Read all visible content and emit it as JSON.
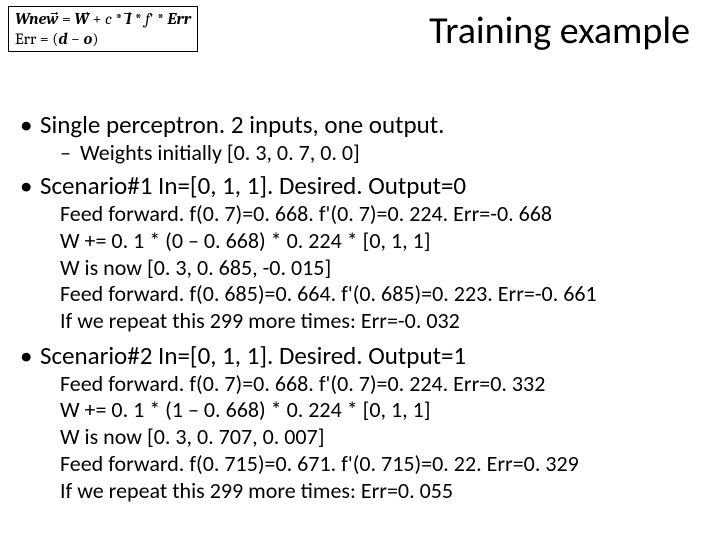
{
  "formula": {
    "line1_html": "<b><i>Wnew</i></b>&#8407; = <b><i>W</i></b>&#8407; + <i>c</i> * <b><i>I</i></b>&#8407; * <i>f</i>' * <b><i>Err</i></b>",
    "line2_html": "Err = (<b><i>d</i></b> &minus; <b><i>o</i></b>)"
  },
  "title": "Training example",
  "bullets": {
    "b1a": "Single perceptron.  2 inputs, one output.",
    "b2a": "Weights initially [0. 3, 0. 7, 0. 0]",
    "b1b": "Scenario#1 In=[0, 1, 1].  Desired. Output=0",
    "body1": [
      "Feed forward.  f(0. 7)=0. 668.  f'(0. 7)=0. 224.  Err=-0. 668",
      "W += 0. 1 * (0 – 0. 668) * 0. 224 * [0, 1, 1]",
      "W is now [0. 3, 0. 685, -0. 015]",
      "Feed forward.  f(0. 685)=0. 664. f'(0. 685)=0. 223. Err=-0. 661",
      "If we repeat this 299 more times: Err=-0. 032"
    ],
    "b1c": "Scenario#2 In=[0, 1, 1].  Desired. Output=1",
    "body2": [
      "Feed forward. f(0. 7)=0. 668. f'(0. 7)=0. 224. Err=0. 332",
      "W += 0. 1 * (1 – 0. 668) * 0. 224 * [0, 1, 1]",
      "W is now [0. 3, 0. 707, 0. 007]",
      "Feed forward. f(0. 715)=0. 671. f'(0. 715)=0. 22. Err=0. 329",
      "If we repeat this 299 more times: Err=0. 055"
    ]
  }
}
